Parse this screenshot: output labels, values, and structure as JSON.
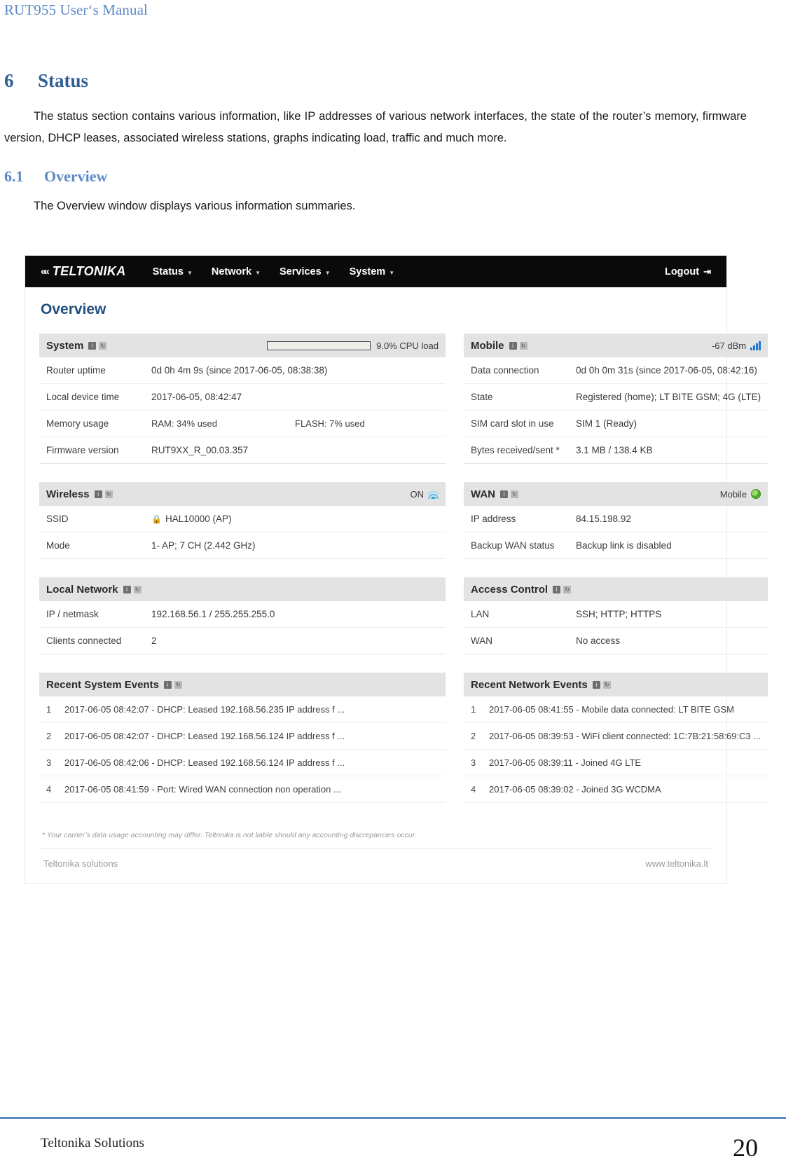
{
  "document": {
    "running_header": "RUT955 User‘s Manual",
    "footer_left": "Teltonika Solutions",
    "page_number": "20"
  },
  "sections": {
    "status": {
      "number": "6",
      "title": "Status",
      "paragraph": "The status section contains various information, like IP addresses of various network interfaces, the state of the router’s memory, firmware version, DHCP leases, associated wireless stations, graphs indicating load, traffic and much more."
    },
    "overview": {
      "number": "6.1",
      "title": "Overview",
      "paragraph": "The Overview window displays various information summaries."
    }
  },
  "screenshot": {
    "navbar": {
      "brand": "TELTONIKA",
      "menu": [
        {
          "label": "Status"
        },
        {
          "label": "Network"
        },
        {
          "label": "Services"
        },
        {
          "label": "System"
        }
      ],
      "logout": "Logout"
    },
    "page_title": "Overview",
    "panels": {
      "system": {
        "title": "System",
        "cpu_load_label": "9.0% CPU load",
        "cpu_load_percent": 9,
        "rows": [
          {
            "key": "Router uptime",
            "value": "0d 0h 4m 9s (since 2017-06-05, 08:38:38)"
          },
          {
            "key": "Local device time",
            "value": "2017-06-05, 08:42:47"
          }
        ],
        "memory": {
          "key": "Memory usage",
          "ram_label": "RAM: 34% used",
          "ram_percent": 34,
          "flash_label": "FLASH: 7% used",
          "flash_percent": 7
        },
        "firmware": {
          "key": "Firmware version",
          "value": "RUT9XX_R_00.03.357"
        }
      },
      "mobile": {
        "title": "Mobile",
        "signal": "-67 dBm",
        "rows": [
          {
            "key": "Data connection",
            "value": "0d 0h 0m 31s (since 2017-06-05, 08:42:16)"
          },
          {
            "key": "State",
            "value": "Registered (home); LT BITE GSM; 4G (LTE)"
          },
          {
            "key": "SIM card slot in use",
            "value": "SIM 1 (Ready)"
          },
          {
            "key": "Bytes received/sent *",
            "value": "3.1 MB / 138.4 KB"
          }
        ]
      },
      "wireless": {
        "title": "Wireless",
        "state": "ON",
        "rows": [
          {
            "key": "SSID",
            "value": "HAL10000 (AP)",
            "locked": true
          },
          {
            "key": "Mode",
            "value": "1- AP; 7 CH (2.442 GHz)"
          }
        ]
      },
      "wan": {
        "title": "WAN",
        "state": "Mobile",
        "rows": [
          {
            "key": "IP address",
            "value": "84.15.198.92"
          },
          {
            "key": "Backup WAN status",
            "value": "Backup link is disabled"
          }
        ]
      },
      "local_network": {
        "title": "Local Network",
        "rows": [
          {
            "key": "IP / netmask",
            "value": "192.168.56.1 / 255.255.255.0"
          },
          {
            "key": "Clients connected",
            "value": "2"
          }
        ]
      },
      "access_control": {
        "title": "Access Control",
        "rows": [
          {
            "key": "LAN",
            "value": "SSH; HTTP; HTTPS"
          },
          {
            "key": "WAN",
            "value": "No access"
          }
        ]
      },
      "recent_system_events": {
        "title": "Recent System Events",
        "events": [
          {
            "index": "1",
            "text": "2017-06-05 08:42:07 - DHCP: Leased 192.168.56.235 IP address f ..."
          },
          {
            "index": "2",
            "text": "2017-06-05 08:42:07 - DHCP: Leased 192.168.56.124 IP address f ..."
          },
          {
            "index": "3",
            "text": "2017-06-05 08:42:06 - DHCP: Leased 192.168.56.124 IP address f ..."
          },
          {
            "index": "4",
            "text": "2017-06-05 08:41:59 - Port: Wired WAN connection non operation ..."
          }
        ]
      },
      "recent_network_events": {
        "title": "Recent Network Events",
        "events": [
          {
            "index": "1",
            "text": "2017-06-05 08:41:55 - Mobile data connected: LT BITE GSM"
          },
          {
            "index": "2",
            "text": "2017-06-05 08:39:53 - WiFi client connected: 1C:7B:21:58:69:C3 ..."
          },
          {
            "index": "3",
            "text": "2017-06-05 08:39:11 - Joined 4G LTE"
          },
          {
            "index": "4",
            "text": "2017-06-05 08:39:02 - Joined 3G WCDMA"
          }
        ]
      }
    },
    "footnote": "* Your carrier’s data usage accounting may differ. Teltonika is not liable should any accounting discrepancies occur.",
    "footer": {
      "left": "Teltonika solutions",
      "right": "www.teltonika.lt"
    }
  },
  "colors": {
    "heading_blue": "#2e5f96",
    "subheading_blue": "#5b8ac5",
    "accent_bar": "#1463d2",
    "navbar_bg": "#0a0a0a"
  }
}
